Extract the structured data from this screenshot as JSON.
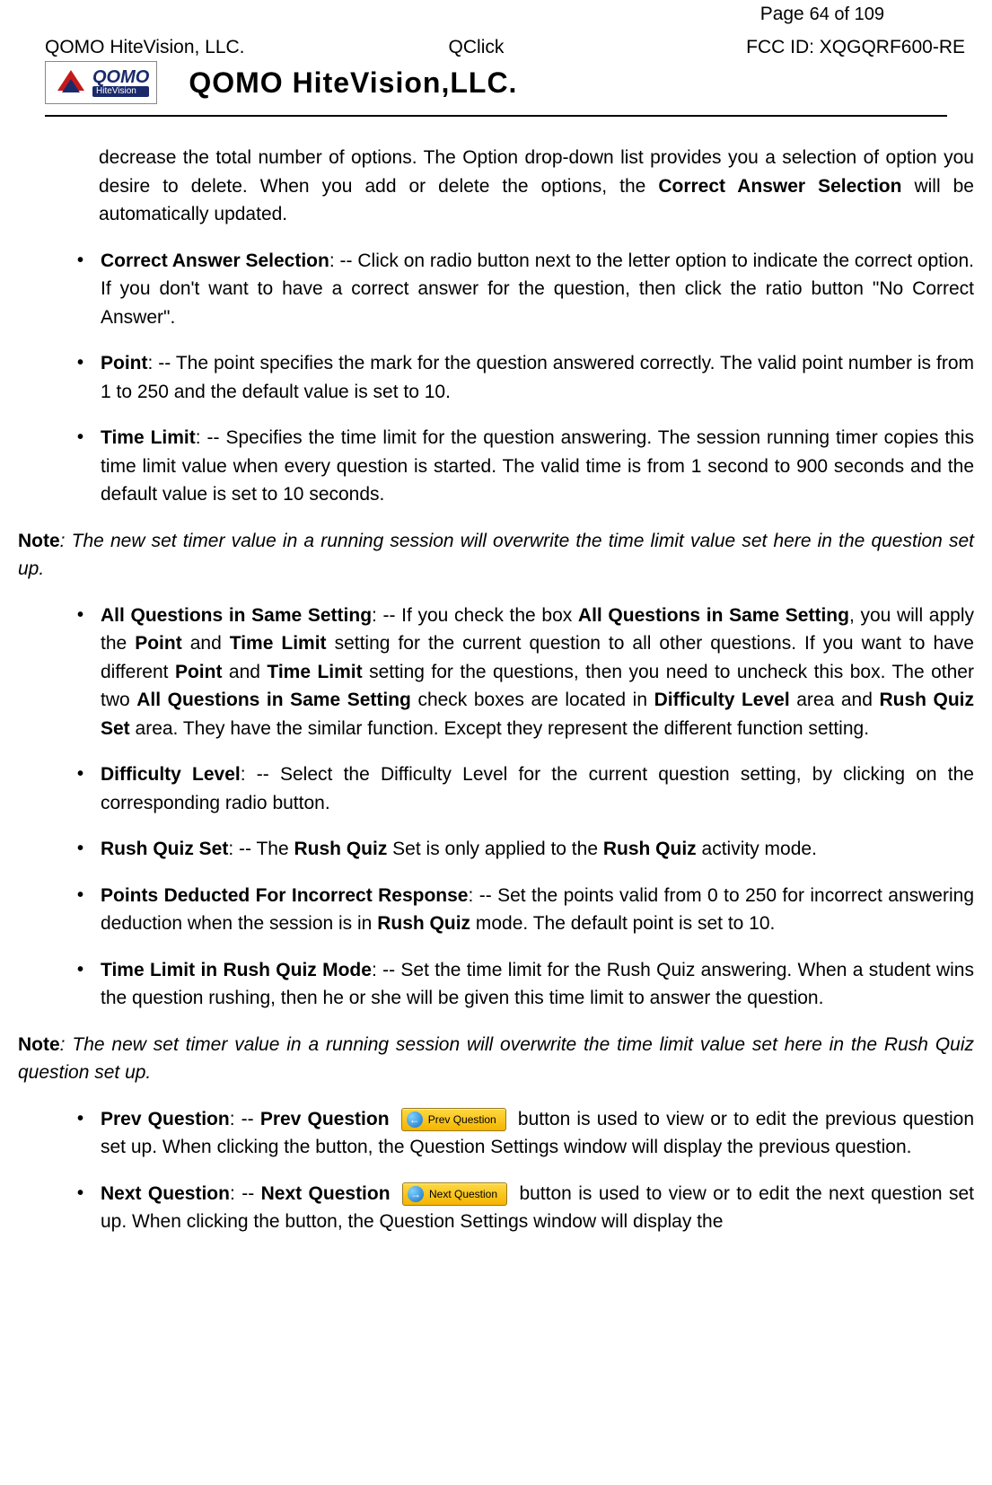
{
  "header": {
    "left": "QOMO HiteVision, LLC.",
    "center": "QClick",
    "page_label": "Page ",
    "page_num": "64 of 109",
    "fcc": "FCC ID: XQGQRF600-RE"
  },
  "logo": {
    "brand_text": "QOMO",
    "brand_sub": "HiteVision",
    "company_title": "QOMO HiteVision,LLC."
  },
  "intro_block": {
    "prefix": "decrease the total number of options. The Option drop-down list provides you a selection of option you desire to delete. When you add or delete the options, the ",
    "bold1": "Correct Answer Selection",
    "suffix": " will be automatically updated."
  },
  "bulletsA": [
    {
      "title": "Correct Answer Selection",
      "body": ": -- Click on radio button next to the letter option to indicate the correct option. If you don't want to have a correct answer for the question, then click the ratio button \"No Correct Answer\"."
    },
    {
      "title": "Point",
      "body": ": -- The point specifies the mark for the question answered correctly. The valid point number is from 1 to 250 and the default value is set to 10."
    },
    {
      "title": "Time Limit",
      "body": ": -- Specifies the time limit for the question answering. The session running timer copies this time limit value when every question is started. The valid time is from 1 second to 900 seconds and the default value is set to 10 seconds."
    }
  ],
  "note1": {
    "label": "Note",
    "text": ": The new set timer value in a running session will overwrite the time limit value set here in the question set up."
  },
  "bulletB_allquestions": {
    "t1": "All Questions in Same Setting",
    "p1": ": -- If you check the box ",
    "t2": "All Questions in Same Setting",
    "p2": ", you will apply the ",
    "t3": "Point",
    "p3": " and ",
    "t4": "Time Limit",
    "p4": " setting for the current question to all other questions. If you want to have different ",
    "t5": "Point",
    "p5": " and ",
    "t6": "Time Limit",
    "p6": " setting for the questions, then you need to uncheck this box. The other two ",
    "t7": "All Questions in Same Setting",
    "p7": " check boxes are located in ",
    "t8": "Difficulty Level",
    "p8": " area and ",
    "t9": "Rush Quiz Set",
    "p9": " area. They have the similar function. Except they represent the different function setting."
  },
  "bulletB_difficulty": {
    "t": "Difficulty Level",
    "body": ": -- Select the Difficulty Level for the current question setting, by clicking on the corresponding radio button."
  },
  "bulletB_rushset": {
    "t1": "Rush Quiz Set",
    "p1": ": -- The ",
    "t2": "Rush Quiz",
    "p2": " Set is only applied to the ",
    "t3": "Rush Quiz",
    "p3": " activity mode."
  },
  "bulletB_pointsded": {
    "t1": "Points Deducted For Incorrect Response",
    "p1": ": -- Set the points valid from 0 to 250 for incorrect answering deduction when the session is in ",
    "t2": "Rush Quiz",
    "p2": " mode. The default point is set to 10."
  },
  "bulletB_timelimitrush": {
    "t": "Time Limit in Rush Quiz Mode",
    "body": ": -- Set the time limit for the Rush Quiz answering. When a student wins the question rushing, then he or she will be given this time limit to answer the question."
  },
  "note2": {
    "label": "Note",
    "text": ": The new set timer value in a running session will overwrite the time limit value set here in the Rush Quiz question set up."
  },
  "bulletC_prev": {
    "title": "Prev Question",
    "colon": ": -- ",
    "title2": "Prev Question",
    "btn_label": "Prev Question",
    "arrow": "←",
    "body": " button is used to view or to edit the previous question set up. When clicking the button, the Question Settings window will display the previous question."
  },
  "bulletC_next": {
    "title": "Next Question",
    "colon": ": -- ",
    "title2": "Next Question",
    "btn_label": "Next Question",
    "arrow": "→",
    "body": " button is used to view or to edit the next question set up. When clicking the button, the Question Settings window will display the"
  }
}
